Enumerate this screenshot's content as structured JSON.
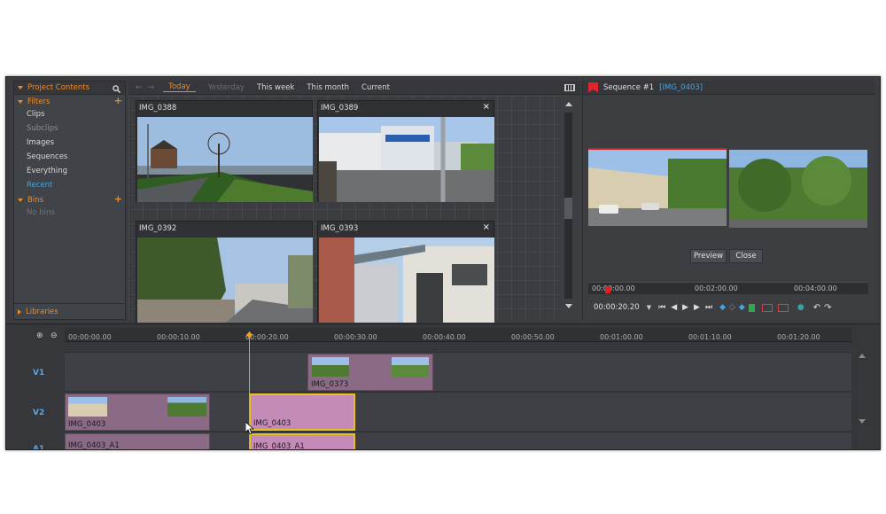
{
  "left_panel": {
    "header": "Project Contents",
    "filters_label": "Filters",
    "filter_items": [
      "Clips",
      "Subclips",
      "Images",
      "Sequences",
      "Everything",
      "Recent"
    ],
    "bins_label": "Bins",
    "bins_empty": "No bins",
    "libraries_label": "Libraries"
  },
  "browser": {
    "tabs": [
      "Today",
      "Yesterday",
      "This week",
      "This month",
      "Current"
    ],
    "active_tab": "Today",
    "thumbnails": [
      {
        "name": "IMG_0388"
      },
      {
        "name": "IMG_0389"
      },
      {
        "name": "IMG_0392"
      },
      {
        "name": "IMG_0393"
      }
    ]
  },
  "sequence": {
    "title": "Sequence #1",
    "clip_ref": "[IMG_0403]",
    "preview_label": "Preview",
    "close_label": "Close",
    "ruler": [
      "00:00:00.00",
      "00:02:00.00",
      "00:04:00.00"
    ],
    "timecode": "00:00:20.20"
  },
  "timeline": {
    "ruler": [
      "00:00:00.00",
      "00:00:10.00",
      "00:00:20.00",
      "00:00:30.00",
      "00:00:40.00",
      "00:00:50.00",
      "00:01:00.00",
      "00:01:10.00",
      "00:01:20.00"
    ],
    "tracks": [
      "V1",
      "V2",
      "A1"
    ],
    "clips": {
      "v1": "IMG_0373",
      "v2_a": "IMG_0403",
      "v2_b": "IMG_0403",
      "a1_a": "IMG_0403_A1",
      "a1_b": "IMG_0403_A1"
    }
  },
  "colors": {
    "accent": "#f08a24",
    "link": "#4aa3e0",
    "clip": "#8a6a84",
    "clip_selected": "#c48ab8"
  }
}
